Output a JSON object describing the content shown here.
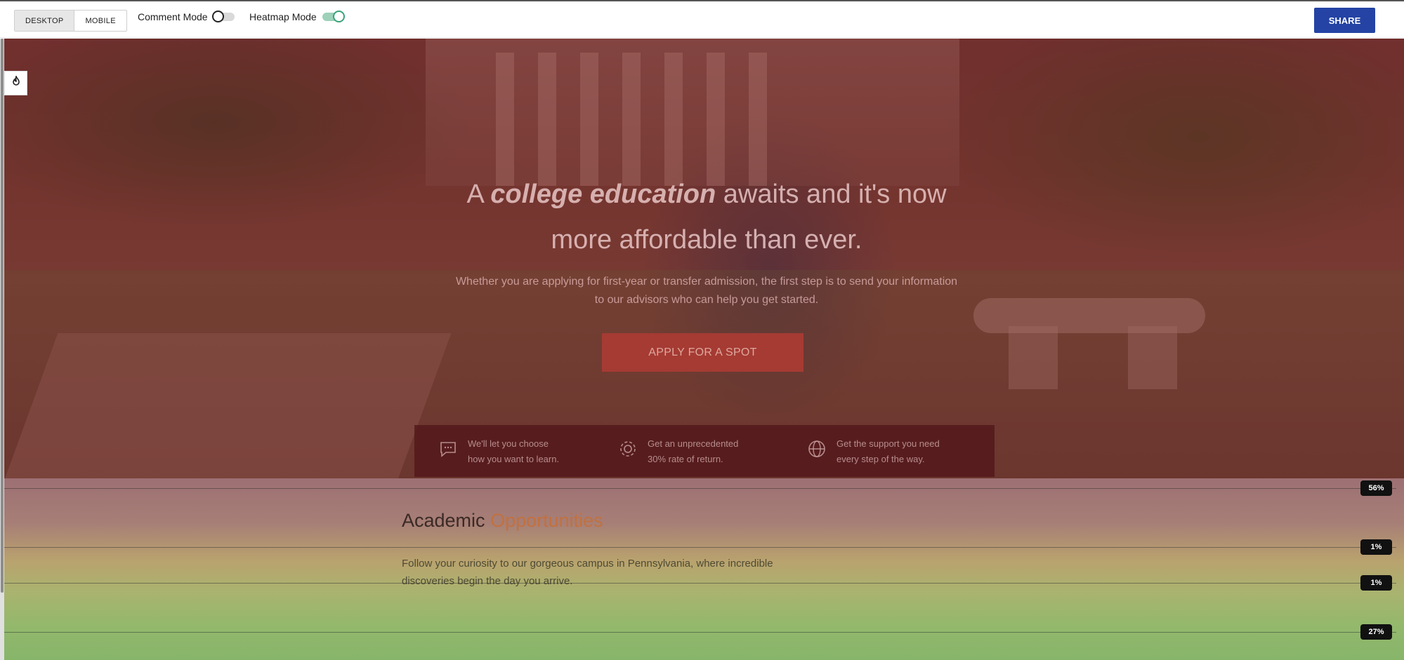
{
  "toolbar": {
    "device_tabs": [
      {
        "label": "DESKTOP",
        "active": true
      },
      {
        "label": "MOBILE",
        "active": false
      }
    ],
    "comment_mode": {
      "label": "Comment Mode",
      "on": false
    },
    "heatmap_mode": {
      "label": "Heatmap Mode",
      "on": true
    },
    "share_label": "SHARE"
  },
  "hero": {
    "title_prefix": "A ",
    "title_emphasis": "college education",
    "title_suffix_line1": " awaits and it's now",
    "title_line2": "more affordable than ever.",
    "subtitle": "Whether you are applying for first-year or transfer admission, the first step is to send your information to our advisors who can help you get started.",
    "cta_label": "APPLY FOR A SPOT",
    "features": [
      {
        "icon": "chat-icon",
        "line1": "We'll let you choose",
        "line2": "how you want to learn."
      },
      {
        "icon": "gear-icon",
        "line1": "Get an unprecedented",
        "line2": "30% rate of return."
      },
      {
        "icon": "globe-icon",
        "line1": "Get the support you need",
        "line2": "every step of the way."
      }
    ]
  },
  "academic": {
    "title_plain": "Academic ",
    "title_accent": "Opportunities",
    "body": "Follow your curiosity to our gorgeous campus in Pennsylvania, where incredible discoveries begin the day you arrive."
  },
  "heatmap": {
    "markers": [
      {
        "label": "56%"
      },
      {
        "label": "1%"
      },
      {
        "label": "1%"
      },
      {
        "label": "27%"
      }
    ]
  },
  "colors": {
    "share_button": "#2443a4",
    "toggle_on": "#3aa37a",
    "accent_orange": "#c2713e",
    "cta": "#a53b33"
  }
}
